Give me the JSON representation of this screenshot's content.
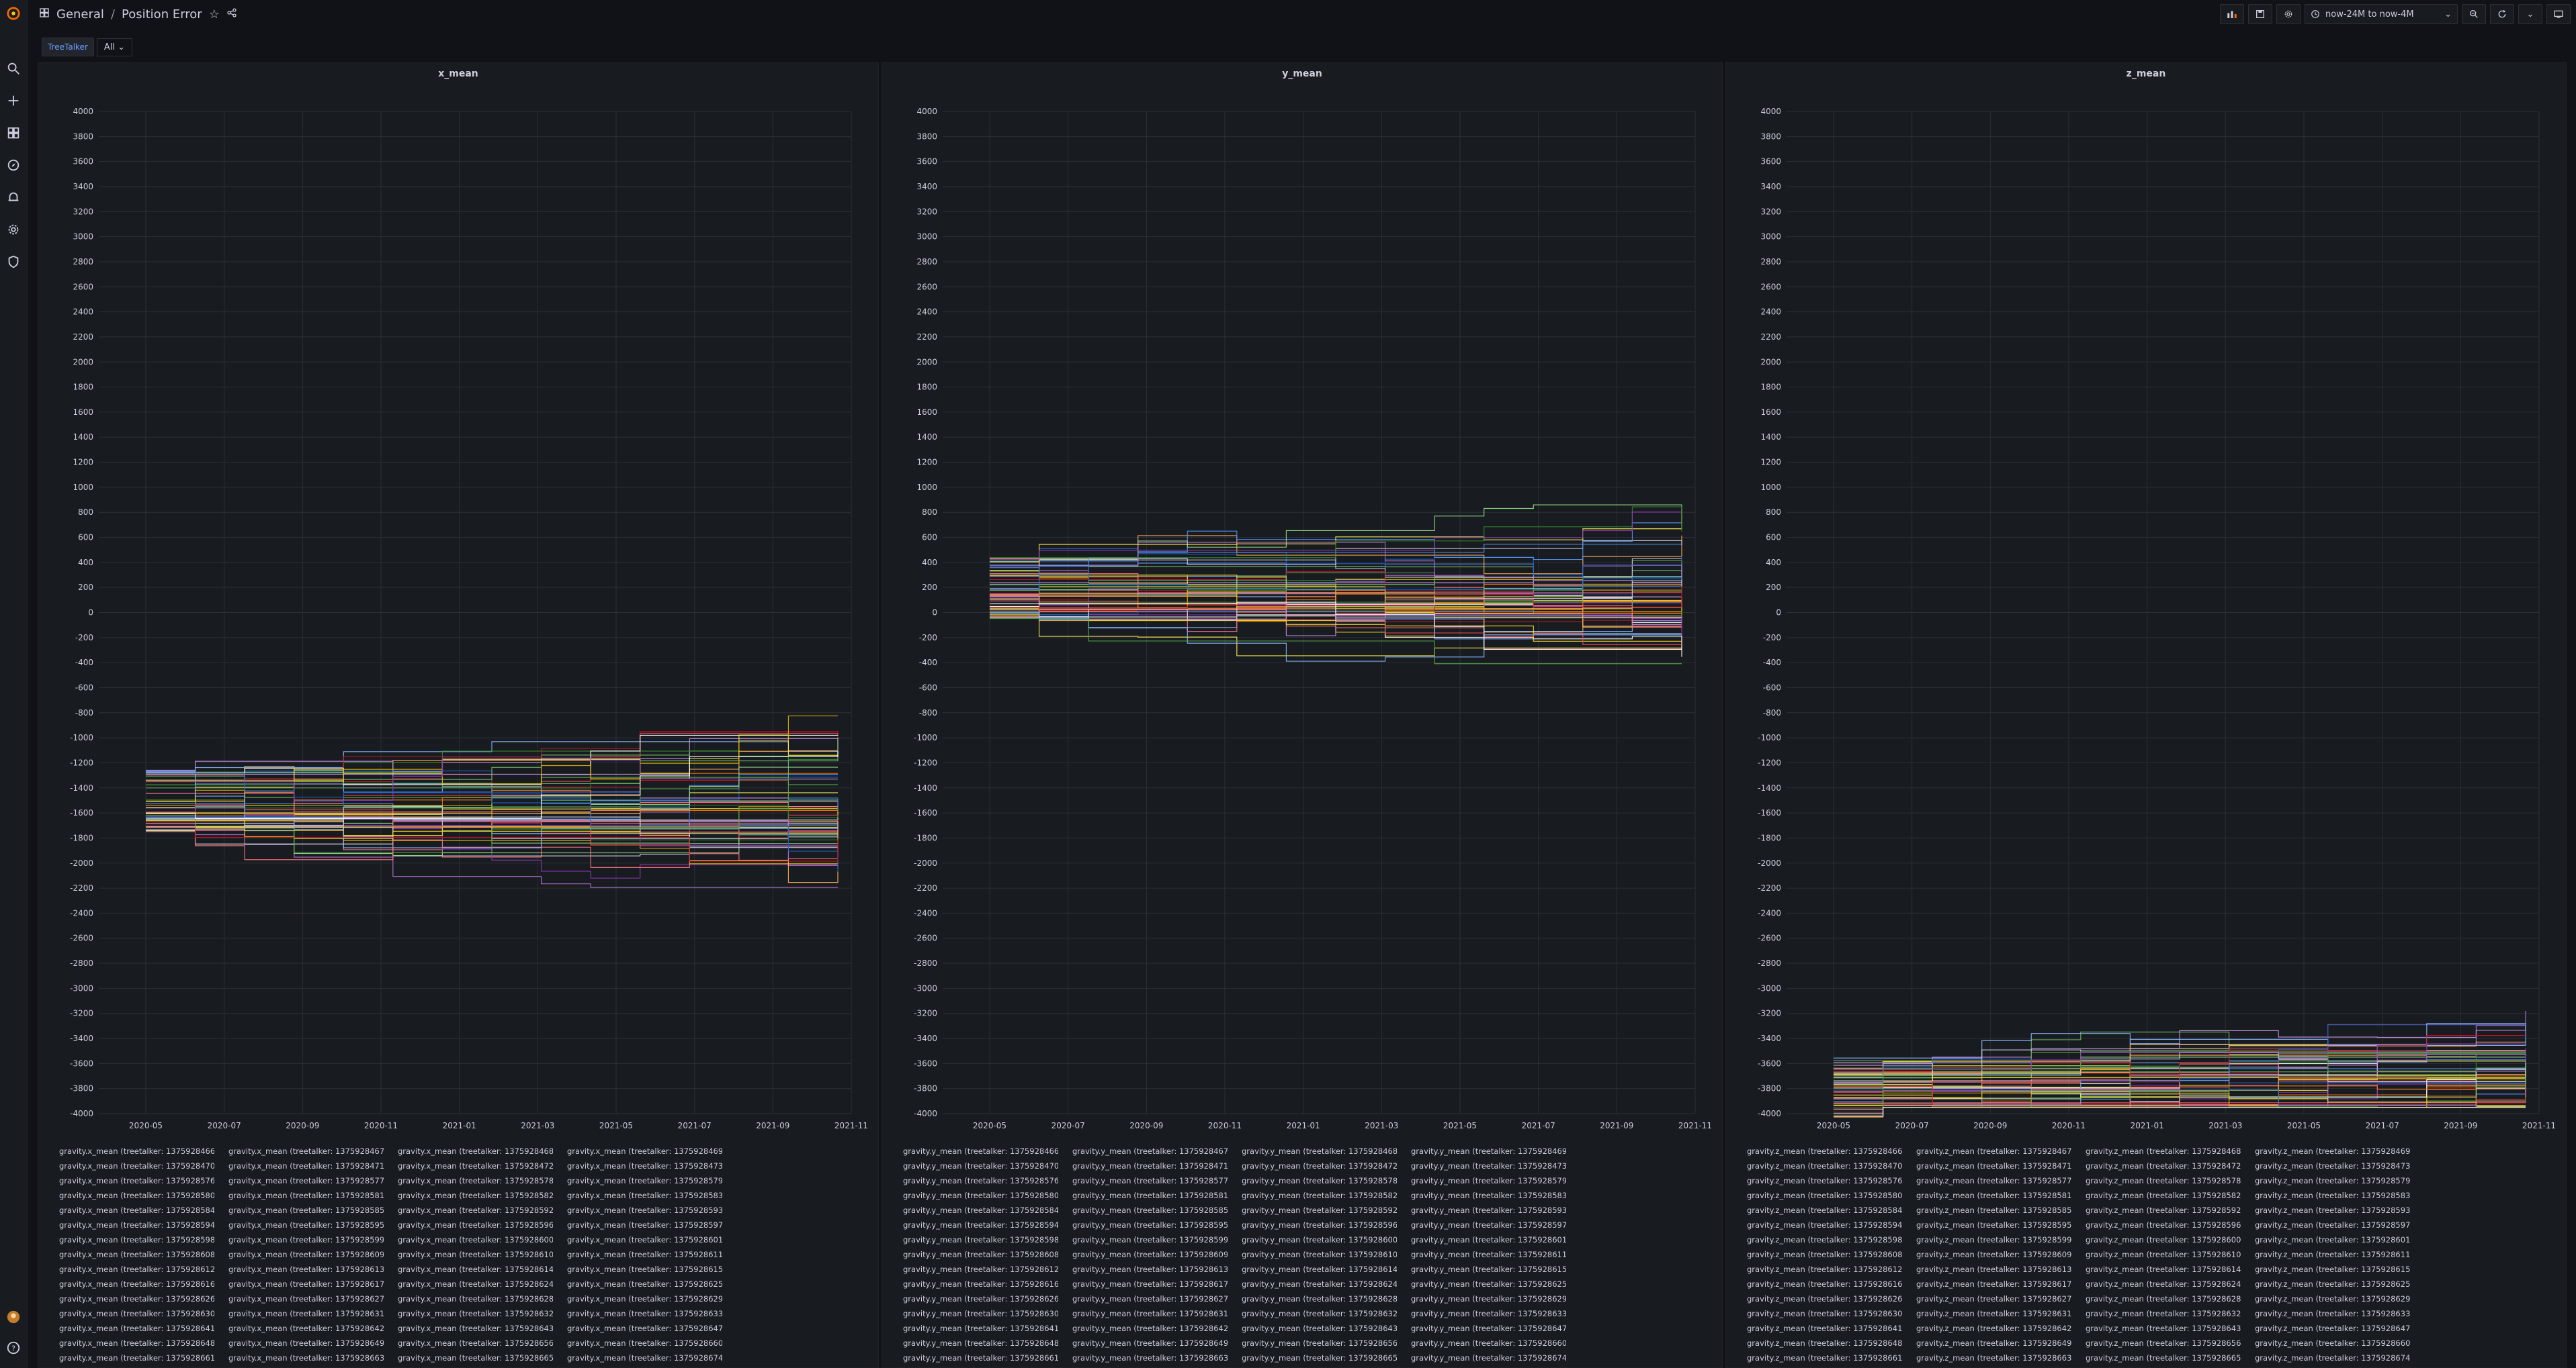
{
  "header": {
    "folder": "General",
    "title": "Position Error",
    "time_range": "now-24M to now-4M"
  },
  "variables": {
    "label": "TreeTalker",
    "value": "All"
  },
  "sidebar": {
    "icons": [
      "grafana-logo-icon",
      "search-icon",
      "plus-icon",
      "dashboards-icon",
      "explore-icon",
      "alerting-icon",
      "configuration-icon",
      "shield-icon"
    ],
    "bottom_icons": [
      "avatar",
      "help-icon"
    ]
  },
  "colors": {
    "bg": "#111217",
    "panel": "#181b1f",
    "grid": "#2c2f36",
    "series_palette": [
      "#73bf69",
      "#fade2a",
      "#5794f2",
      "#ff780a",
      "#f2495c",
      "#b877d9",
      "#96d98d",
      "#ffee52",
      "#8ab8ff",
      "#ffb357",
      "#ff7383",
      "#ca95e5",
      "#ccccdc",
      "#37872d",
      "#e0b400",
      "#1f60c4",
      "#c4162a",
      "#8f3bb8",
      "#56a64b",
      "#ffffff"
    ]
  },
  "chart_data": [
    {
      "type": "line",
      "title": "x_mean",
      "ylim": [
        -4000,
        4000
      ],
      "y_ticks": [
        "4000",
        "3800",
        "3600",
        "3400",
        "3200",
        "3000",
        "2800",
        "2600",
        "2400",
        "2200",
        "2000",
        "1800",
        "1600",
        "1400",
        "1200",
        "1000",
        "800",
        "600",
        "400",
        "200",
        "0",
        "-200",
        "-400",
        "-600",
        "-800",
        "-1000",
        "-1200",
        "-1400",
        "-1600",
        "-1800",
        "-2000",
        "-2200",
        "-2400",
        "-2600",
        "-2800",
        "-3000",
        "-3200",
        "-3400",
        "-3600",
        "-3800",
        "-4000"
      ],
      "x_ticks": [
        "2020-05",
        "2020-07",
        "2020-09",
        "2020-11",
        "2021-01",
        "2021-03",
        "2021-05",
        "2021-07",
        "2021-09",
        "2021-11"
      ],
      "grid": true,
      "legend_position": "bottom",
      "series_baseline": -1500,
      "legend": [
        [
          "gravity.x_mean (treetalker: 1375928466)",
          "gravity.x_mean (treetalker: 1375928467)",
          "gravity.x_mean (treetalker: 1375928468)",
          "gravity.x_mean (treetalker: 1375928469)"
        ],
        [
          "gravity.x_mean (treetalker: 1375928470)",
          "gravity.x_mean (treetalker: 1375928471)",
          "gravity.x_mean (treetalker: 1375928472)",
          "gravity.x_mean (treetalker: 1375928473)"
        ],
        [
          "gravity.x_mean (treetalker: 1375928576)",
          "gravity.x_mean (treetalker: 1375928577)",
          "gravity.x_mean (treetalker: 1375928578)",
          "gravity.x_mean (treetalker: 1375928579)"
        ],
        [
          "gravity.x_mean (treetalker: 1375928580)",
          "gravity.x_mean (treetalker: 1375928581)",
          "gravity.x_mean (treetalker: 1375928582)",
          "gravity.x_mean (treetalker: 1375928583)"
        ],
        [
          "gravity.x_mean (treetalker: 1375928584)",
          "gravity.x_mean (treetalker: 1375928585)",
          "gravity.x_mean (treetalker: 1375928592)",
          "gravity.x_mean (treetalker: 1375928593)"
        ],
        [
          "gravity.x_mean (treetalker: 1375928594)",
          "gravity.x_mean (treetalker: 1375928595)",
          "gravity.x_mean (treetalker: 1375928596)",
          "gravity.x_mean (treetalker: 1375928597)"
        ],
        [
          "gravity.x_mean (treetalker: 1375928598)",
          "gravity.x_mean (treetalker: 1375928599)",
          "gravity.x_mean (treetalker: 1375928600)",
          "gravity.x_mean (treetalker: 1375928601)"
        ],
        [
          "gravity.x_mean (treetalker: 1375928608)",
          "gravity.x_mean (treetalker: 1375928609)",
          "gravity.x_mean (treetalker: 1375928610)",
          "gravity.x_mean (treetalker: 1375928611)"
        ],
        [
          "gravity.x_mean (treetalker: 1375928612)",
          "gravity.x_mean (treetalker: 1375928613)",
          "gravity.x_mean (treetalker: 1375928614)",
          "gravity.x_mean (treetalker: 1375928615)"
        ],
        [
          "gravity.x_mean (treetalker: 1375928616)",
          "gravity.x_mean (treetalker: 1375928617)",
          "gravity.x_mean (treetalker: 1375928624)",
          "gravity.x_mean (treetalker: 1375928625)"
        ],
        [
          "gravity.x_mean (treetalker: 1375928626)",
          "gravity.x_mean (treetalker: 1375928627)",
          "gravity.x_mean (treetalker: 1375928628)",
          "gravity.x_mean (treetalker: 1375928629)"
        ],
        [
          "gravity.x_mean (treetalker: 1375928630)",
          "gravity.x_mean (treetalker: 1375928631)",
          "gravity.x_mean (treetalker: 1375928632)",
          "gravity.x_mean (treetalker: 1375928633)"
        ],
        [
          "gravity.x_mean (treetalker: 1375928641)",
          "gravity.x_mean (treetalker: 1375928642)",
          "gravity.x_mean (treetalker: 1375928643)",
          "gravity.x_mean (treetalker: 1375928647)"
        ],
        [
          "gravity.x_mean (treetalker: 1375928648)",
          "gravity.x_mean (treetalker: 1375928649)",
          "gravity.x_mean (treetalker: 1375928656)",
          "gravity.x_mean (treetalker: 1375928660)"
        ],
        [
          "gravity.x_mean (treetalker: 1375928661)",
          "gravity.x_mean (treetalker: 1375928663)",
          "gravity.x_mean (treetalker: 1375928665)",
          "gravity.x_mean (treetalker: 1375928674)"
        ]
      ]
    },
    {
      "type": "line",
      "title": "y_mean",
      "ylim": [
        -4000,
        4000
      ],
      "y_ticks": [
        "4000",
        "3800",
        "3600",
        "3400",
        "3200",
        "3000",
        "2800",
        "2600",
        "2400",
        "2200",
        "2000",
        "1800",
        "1600",
        "1400",
        "1200",
        "1000",
        "800",
        "600",
        "400",
        "200",
        "0",
        "-200",
        "-400",
        "-600",
        "-800",
        "-1000",
        "-1200",
        "-1400",
        "-1600",
        "-1800",
        "-2000",
        "-2200",
        "-2400",
        "-2600",
        "-2800",
        "-3000",
        "-3200",
        "-3400",
        "-3600",
        "-3800",
        "-4000"
      ],
      "x_ticks": [
        "2020-05",
        "2020-07",
        "2020-09",
        "2020-11",
        "2021-01",
        "2021-03",
        "2021-05",
        "2021-07",
        "2021-09",
        "2021-11"
      ],
      "grid": true,
      "legend_position": "bottom",
      "series_baseline": 200,
      "legend": [
        [
          "gravity.y_mean (treetalker: 1375928466)",
          "gravity.y_mean (treetalker: 1375928467)",
          "gravity.y_mean (treetalker: 1375928468)",
          "gravity.y_mean (treetalker: 1375928469)"
        ],
        [
          "gravity.y_mean (treetalker: 1375928470)",
          "gravity.y_mean (treetalker: 1375928471)",
          "gravity.y_mean (treetalker: 1375928472)",
          "gravity.y_mean (treetalker: 1375928473)"
        ],
        [
          "gravity.y_mean (treetalker: 1375928576)",
          "gravity.y_mean (treetalker: 1375928577)",
          "gravity.y_mean (treetalker: 1375928578)",
          "gravity.y_mean (treetalker: 1375928579)"
        ],
        [
          "gravity.y_mean (treetalker: 1375928580)",
          "gravity.y_mean (treetalker: 1375928581)",
          "gravity.y_mean (treetalker: 1375928582)",
          "gravity.y_mean (treetalker: 1375928583)"
        ],
        [
          "gravity.y_mean (treetalker: 1375928584)",
          "gravity.y_mean (treetalker: 1375928585)",
          "gravity.y_mean (treetalker: 1375928592)",
          "gravity.y_mean (treetalker: 1375928593)"
        ],
        [
          "gravity.y_mean (treetalker: 1375928594)",
          "gravity.y_mean (treetalker: 1375928595)",
          "gravity.y_mean (treetalker: 1375928596)",
          "gravity.y_mean (treetalker: 1375928597)"
        ],
        [
          "gravity.y_mean (treetalker: 1375928598)",
          "gravity.y_mean (treetalker: 1375928599)",
          "gravity.y_mean (treetalker: 1375928600)",
          "gravity.y_mean (treetalker: 1375928601)"
        ],
        [
          "gravity.y_mean (treetalker: 1375928608)",
          "gravity.y_mean (treetalker: 1375928609)",
          "gravity.y_mean (treetalker: 1375928610)",
          "gravity.y_mean (treetalker: 1375928611)"
        ],
        [
          "gravity.y_mean (treetalker: 1375928612)",
          "gravity.y_mean (treetalker: 1375928613)",
          "gravity.y_mean (treetalker: 1375928614)",
          "gravity.y_mean (treetalker: 1375928615)"
        ],
        [
          "gravity.y_mean (treetalker: 1375928616)",
          "gravity.y_mean (treetalker: 1375928617)",
          "gravity.y_mean (treetalker: 1375928624)",
          "gravity.y_mean (treetalker: 1375928625)"
        ],
        [
          "gravity.y_mean (treetalker: 1375928626)",
          "gravity.y_mean (treetalker: 1375928627)",
          "gravity.y_mean (treetalker: 1375928628)",
          "gravity.y_mean (treetalker: 1375928629)"
        ],
        [
          "gravity.y_mean (treetalker: 1375928630)",
          "gravity.y_mean (treetalker: 1375928631)",
          "gravity.y_mean (treetalker: 1375928632)",
          "gravity.y_mean (treetalker: 1375928633)"
        ],
        [
          "gravity.y_mean (treetalker: 1375928641)",
          "gravity.y_mean (treetalker: 1375928642)",
          "gravity.y_mean (treetalker: 1375928643)",
          "gravity.y_mean (treetalker: 1375928647)"
        ],
        [
          "gravity.y_mean (treetalker: 1375928648)",
          "gravity.y_mean (treetalker: 1375928649)",
          "gravity.y_mean (treetalker: 1375928656)",
          "gravity.y_mean (treetalker: 1375928660)"
        ],
        [
          "gravity.y_mean (treetalker: 1375928661)",
          "gravity.y_mean (treetalker: 1375928663)",
          "gravity.y_mean (treetalker: 1375928665)",
          "gravity.y_mean (treetalker: 1375928674)"
        ]
      ]
    },
    {
      "type": "line",
      "title": "z_mean",
      "ylim": [
        -4000,
        4000
      ],
      "y_ticks": [
        "4000",
        "3800",
        "3600",
        "3400",
        "3200",
        "3000",
        "2800",
        "2600",
        "2400",
        "2200",
        "2000",
        "1800",
        "1600",
        "1400",
        "1200",
        "1000",
        "800",
        "600",
        "400",
        "200",
        "0",
        "-200",
        "-400",
        "-600",
        "-800",
        "-1000",
        "-1200",
        "-1400",
        "-1600",
        "-1800",
        "-2000",
        "-2200",
        "-2400",
        "-2600",
        "-2800",
        "-3000",
        "-3200",
        "-3400",
        "-3600",
        "-3800",
        "-4000"
      ],
      "x_ticks": [
        "2020-05",
        "2020-07",
        "2020-09",
        "2020-11",
        "2021-01",
        "2021-03",
        "2021-05",
        "2021-07",
        "2021-09",
        "2021-11"
      ],
      "grid": true,
      "legend_position": "bottom",
      "series_baseline": -3800,
      "legend": [
        [
          "gravity.z_mean (treetalker: 1375928466)",
          "gravity.z_mean (treetalker: 1375928467)",
          "gravity.z_mean (treetalker: 1375928468)",
          "gravity.z_mean (treetalker: 1375928469)"
        ],
        [
          "gravity.z_mean (treetalker: 1375928470)",
          "gravity.z_mean (treetalker: 1375928471)",
          "gravity.z_mean (treetalker: 1375928472)",
          "gravity.z_mean (treetalker: 1375928473)"
        ],
        [
          "gravity.z_mean (treetalker: 1375928576)",
          "gravity.z_mean (treetalker: 1375928577)",
          "gravity.z_mean (treetalker: 1375928578)",
          "gravity.z_mean (treetalker: 1375928579)"
        ],
        [
          "gravity.z_mean (treetalker: 1375928580)",
          "gravity.z_mean (treetalker: 1375928581)",
          "gravity.z_mean (treetalker: 1375928582)",
          "gravity.z_mean (treetalker: 1375928583)"
        ],
        [
          "gravity.z_mean (treetalker: 1375928584)",
          "gravity.z_mean (treetalker: 1375928585)",
          "gravity.z_mean (treetalker: 1375928592)",
          "gravity.z_mean (treetalker: 1375928593)"
        ],
        [
          "gravity.z_mean (treetalker: 1375928594)",
          "gravity.z_mean (treetalker: 1375928595)",
          "gravity.z_mean (treetalker: 1375928596)",
          "gravity.z_mean (treetalker: 1375928597)"
        ],
        [
          "gravity.z_mean (treetalker: 1375928598)",
          "gravity.z_mean (treetalker: 1375928599)",
          "gravity.z_mean (treetalker: 1375928600)",
          "gravity.z_mean (treetalker: 1375928601)"
        ],
        [
          "gravity.z_mean (treetalker: 1375928608)",
          "gravity.z_mean (treetalker: 1375928609)",
          "gravity.z_mean (treetalker: 1375928610)",
          "gravity.z_mean (treetalker: 1375928611)"
        ],
        [
          "gravity.z_mean (treetalker: 1375928612)",
          "gravity.z_mean (treetalker: 1375928613)",
          "gravity.z_mean (treetalker: 1375928614)",
          "gravity.z_mean (treetalker: 1375928615)"
        ],
        [
          "gravity.z_mean (treetalker: 1375928616)",
          "gravity.z_mean (treetalker: 1375928617)",
          "gravity.z_mean (treetalker: 1375928624)",
          "gravity.z_mean (treetalker: 1375928625)"
        ],
        [
          "gravity.z_mean (treetalker: 1375928626)",
          "gravity.z_mean (treetalker: 1375928627)",
          "gravity.z_mean (treetalker: 1375928628)",
          "gravity.z_mean (treetalker: 1375928629)"
        ],
        [
          "gravity.z_mean (treetalker: 1375928630)",
          "gravity.z_mean (treetalker: 1375928631)",
          "gravity.z_mean (treetalker: 1375928632)",
          "gravity.z_mean (treetalker: 1375928633)"
        ],
        [
          "gravity.z_mean (treetalker: 1375928641)",
          "gravity.z_mean (treetalker: 1375928642)",
          "gravity.z_mean (treetalker: 1375928643)",
          "gravity.z_mean (treetalker: 1375928647)"
        ],
        [
          "gravity.z_mean (treetalker: 1375928648)",
          "gravity.z_mean (treetalker: 1375928649)",
          "gravity.z_mean (treetalker: 1375928656)",
          "gravity.z_mean (treetalker: 1375928660)"
        ],
        [
          "gravity.z_mean (treetalker: 1375928661)",
          "gravity.z_mean (treetalker: 1375928663)",
          "gravity.z_mean (treetalker: 1375928665)",
          "gravity.z_mean (treetalker: 1375928674)"
        ]
      ]
    }
  ]
}
